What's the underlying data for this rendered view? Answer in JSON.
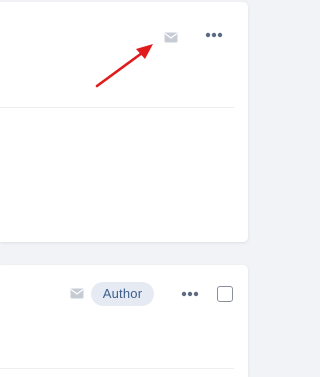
{
  "cards": [
    {
      "icons": {
        "mail": "envelope-icon",
        "more": "more-horizontal-icon"
      }
    },
    {
      "badge": "Author",
      "icons": {
        "mail": "envelope-icon",
        "more": "more-horizontal-icon"
      },
      "checkbox_checked": false
    }
  ],
  "annotation": {
    "type": "red-arrow",
    "color": "#e01b1b"
  },
  "colors": {
    "background": "#f2f3f7",
    "card": "#ffffff",
    "icon_light": "#c7ccd4",
    "icon_dark": "#5c6b82",
    "badge_bg": "#e6ebf3",
    "badge_text": "#3c5f8c"
  }
}
